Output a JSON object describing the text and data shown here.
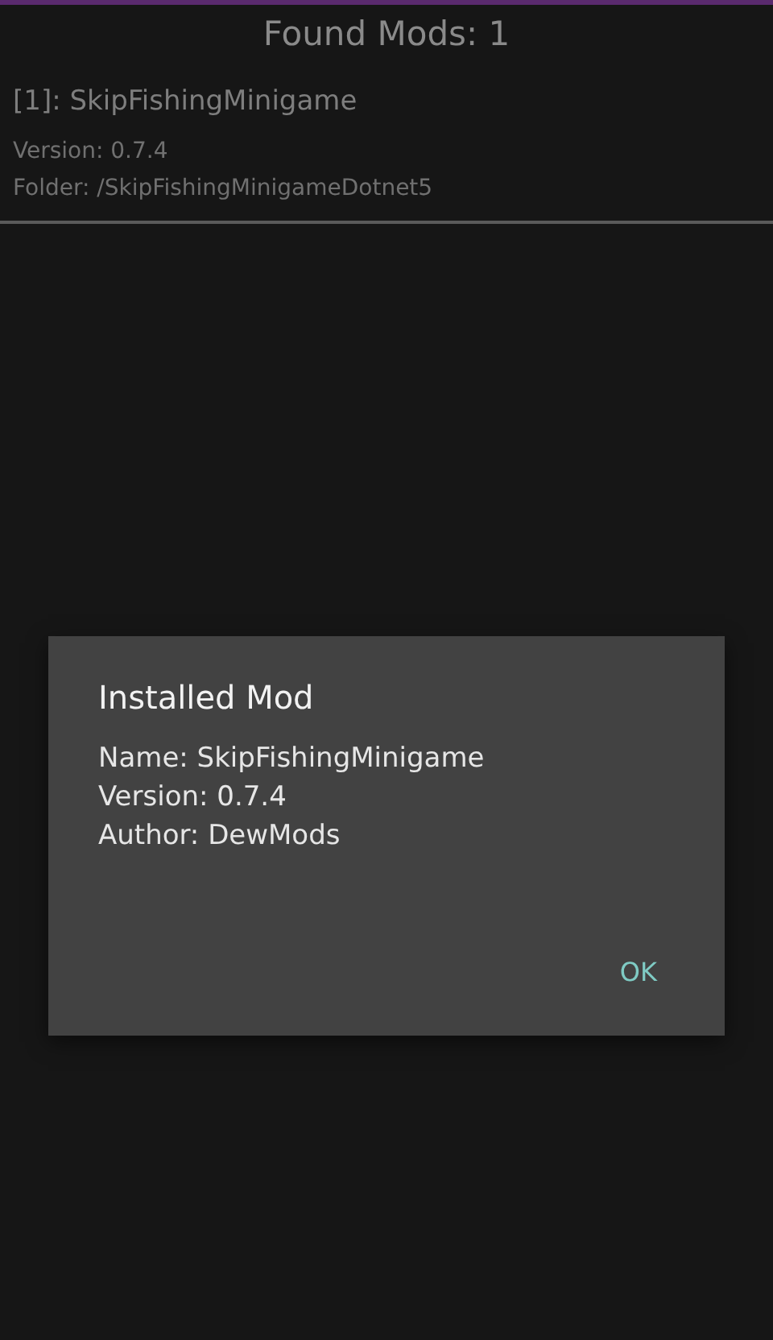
{
  "header": {
    "title": "Found Mods: 1"
  },
  "mods": [
    {
      "title": "[1]: SkipFishingMinigame",
      "version": "Version: 0.7.4",
      "folder": "Folder: /SkipFishingMinigameDotnet5"
    }
  ],
  "dialog": {
    "title": "Installed Mod",
    "lines": [
      "Name: SkipFishingMinigame",
      "Version: 0.7.4",
      "Author: DewMods"
    ],
    "buttons": [
      "OK"
    ]
  }
}
